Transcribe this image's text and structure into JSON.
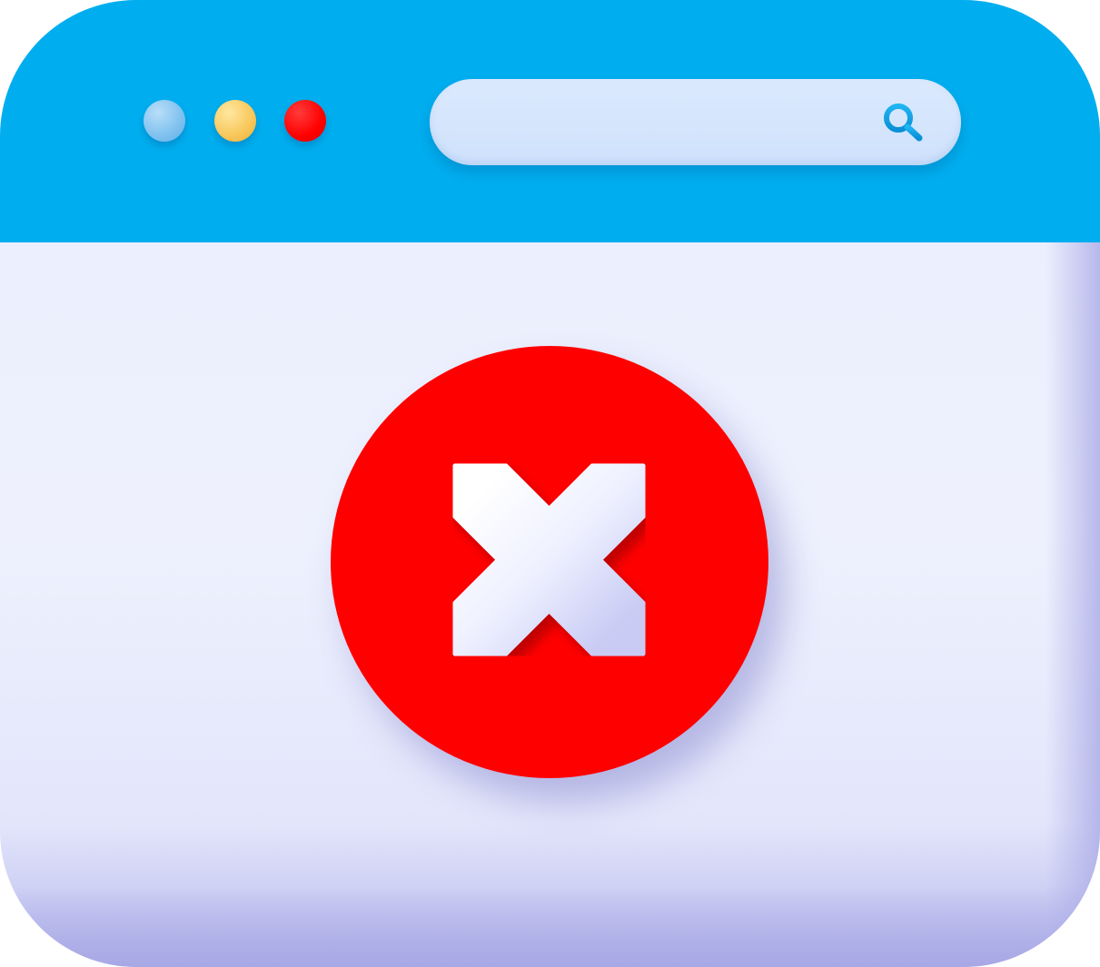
{
  "window": {
    "titlebar_color": "#00aeef",
    "body_color": "#eceffd"
  },
  "titlebar": {
    "controls": [
      {
        "name": "dot-blue",
        "color": "#7fc1ef"
      },
      {
        "name": "dot-yellow",
        "color": "#f7c75a"
      },
      {
        "name": "dot-red",
        "color": "#ff0000"
      }
    ]
  },
  "search": {
    "value": "",
    "placeholder": "",
    "icon": "search-icon",
    "icon_color": "#0d9fe0"
  },
  "error": {
    "icon": "close-icon",
    "circle_color": "#ff0000",
    "cross_color": "#f1f2ff"
  }
}
